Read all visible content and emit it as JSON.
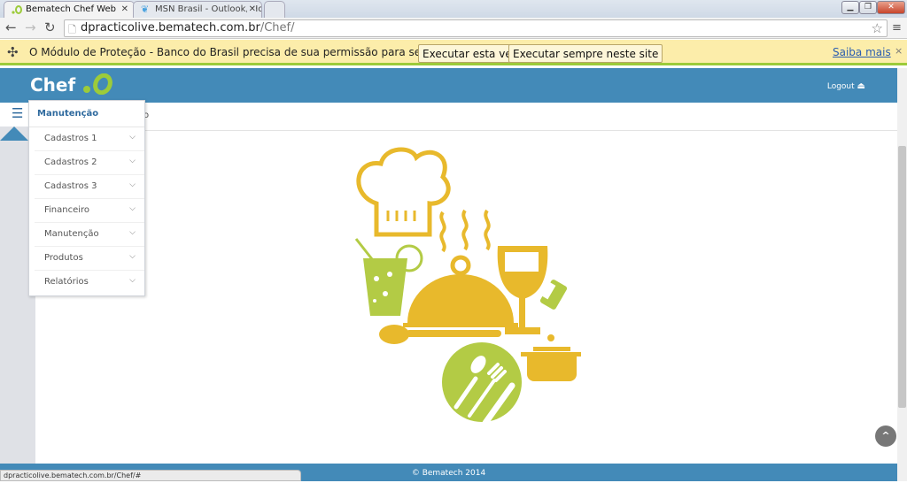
{
  "browser": {
    "tabs": [
      {
        "label": "Bematech Chef Web",
        "active": true
      },
      {
        "label": "MSN Brasil - Outlook, Hot",
        "active": false
      }
    ],
    "url_host": "dpracticolive.bematech.com.br",
    "url_path": "/Chef/",
    "infobar": {
      "message": "O Módulo de Proteção - Banco do Brasil precisa de sua permissão para ser executado.",
      "run_once": "Executar esta vez",
      "run_always": "Executar sempre neste site",
      "learn_more": "Saiba mais",
      "close": "×"
    },
    "status_url": "dpracticolive.bematech.com.br/Chef/#"
  },
  "header": {
    "logo": "Chef",
    "logout": "Logout"
  },
  "breadcrumb": "o",
  "menu": {
    "title": "Manutenção",
    "items": [
      {
        "label": "Cadastros 1"
      },
      {
        "label": "Cadastros 2"
      },
      {
        "label": "Cadastros 3"
      },
      {
        "label": "Financeiro"
      },
      {
        "label": "Manutenção"
      },
      {
        "label": "Produtos"
      },
      {
        "label": "Relatórios"
      }
    ]
  },
  "footer": "© Bematech 2014",
  "colors": {
    "header": "#438ab8",
    "yellow": "#e8b92c",
    "green": "#b3cb45",
    "infobar": "#fcedaa"
  }
}
